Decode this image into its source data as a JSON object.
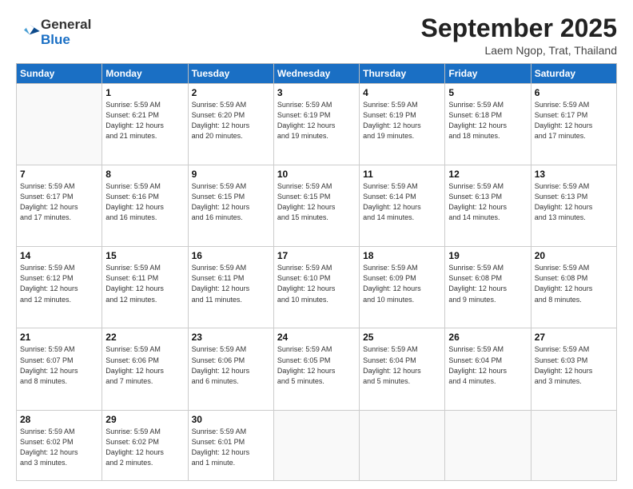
{
  "logo": {
    "general": "General",
    "blue": "Blue"
  },
  "title": "September 2025",
  "location": "Laem Ngop, Trat, Thailand",
  "weekdays": [
    "Sunday",
    "Monday",
    "Tuesday",
    "Wednesday",
    "Thursday",
    "Friday",
    "Saturday"
  ],
  "weeks": [
    [
      {
        "day": "",
        "info": ""
      },
      {
        "day": "1",
        "info": "Sunrise: 5:59 AM\nSunset: 6:21 PM\nDaylight: 12 hours\nand 21 minutes."
      },
      {
        "day": "2",
        "info": "Sunrise: 5:59 AM\nSunset: 6:20 PM\nDaylight: 12 hours\nand 20 minutes."
      },
      {
        "day": "3",
        "info": "Sunrise: 5:59 AM\nSunset: 6:19 PM\nDaylight: 12 hours\nand 19 minutes."
      },
      {
        "day": "4",
        "info": "Sunrise: 5:59 AM\nSunset: 6:19 PM\nDaylight: 12 hours\nand 19 minutes."
      },
      {
        "day": "5",
        "info": "Sunrise: 5:59 AM\nSunset: 6:18 PM\nDaylight: 12 hours\nand 18 minutes."
      },
      {
        "day": "6",
        "info": "Sunrise: 5:59 AM\nSunset: 6:17 PM\nDaylight: 12 hours\nand 17 minutes."
      }
    ],
    [
      {
        "day": "7",
        "info": "Sunrise: 5:59 AM\nSunset: 6:17 PM\nDaylight: 12 hours\nand 17 minutes."
      },
      {
        "day": "8",
        "info": "Sunrise: 5:59 AM\nSunset: 6:16 PM\nDaylight: 12 hours\nand 16 minutes."
      },
      {
        "day": "9",
        "info": "Sunrise: 5:59 AM\nSunset: 6:15 PM\nDaylight: 12 hours\nand 16 minutes."
      },
      {
        "day": "10",
        "info": "Sunrise: 5:59 AM\nSunset: 6:15 PM\nDaylight: 12 hours\nand 15 minutes."
      },
      {
        "day": "11",
        "info": "Sunrise: 5:59 AM\nSunset: 6:14 PM\nDaylight: 12 hours\nand 14 minutes."
      },
      {
        "day": "12",
        "info": "Sunrise: 5:59 AM\nSunset: 6:13 PM\nDaylight: 12 hours\nand 14 minutes."
      },
      {
        "day": "13",
        "info": "Sunrise: 5:59 AM\nSunset: 6:13 PM\nDaylight: 12 hours\nand 13 minutes."
      }
    ],
    [
      {
        "day": "14",
        "info": "Sunrise: 5:59 AM\nSunset: 6:12 PM\nDaylight: 12 hours\nand 12 minutes."
      },
      {
        "day": "15",
        "info": "Sunrise: 5:59 AM\nSunset: 6:11 PM\nDaylight: 12 hours\nand 12 minutes."
      },
      {
        "day": "16",
        "info": "Sunrise: 5:59 AM\nSunset: 6:11 PM\nDaylight: 12 hours\nand 11 minutes."
      },
      {
        "day": "17",
        "info": "Sunrise: 5:59 AM\nSunset: 6:10 PM\nDaylight: 12 hours\nand 10 minutes."
      },
      {
        "day": "18",
        "info": "Sunrise: 5:59 AM\nSunset: 6:09 PM\nDaylight: 12 hours\nand 10 minutes."
      },
      {
        "day": "19",
        "info": "Sunrise: 5:59 AM\nSunset: 6:08 PM\nDaylight: 12 hours\nand 9 minutes."
      },
      {
        "day": "20",
        "info": "Sunrise: 5:59 AM\nSunset: 6:08 PM\nDaylight: 12 hours\nand 8 minutes."
      }
    ],
    [
      {
        "day": "21",
        "info": "Sunrise: 5:59 AM\nSunset: 6:07 PM\nDaylight: 12 hours\nand 8 minutes."
      },
      {
        "day": "22",
        "info": "Sunrise: 5:59 AM\nSunset: 6:06 PM\nDaylight: 12 hours\nand 7 minutes."
      },
      {
        "day": "23",
        "info": "Sunrise: 5:59 AM\nSunset: 6:06 PM\nDaylight: 12 hours\nand 6 minutes."
      },
      {
        "day": "24",
        "info": "Sunrise: 5:59 AM\nSunset: 6:05 PM\nDaylight: 12 hours\nand 5 minutes."
      },
      {
        "day": "25",
        "info": "Sunrise: 5:59 AM\nSunset: 6:04 PM\nDaylight: 12 hours\nand 5 minutes."
      },
      {
        "day": "26",
        "info": "Sunrise: 5:59 AM\nSunset: 6:04 PM\nDaylight: 12 hours\nand 4 minutes."
      },
      {
        "day": "27",
        "info": "Sunrise: 5:59 AM\nSunset: 6:03 PM\nDaylight: 12 hours\nand 3 minutes."
      }
    ],
    [
      {
        "day": "28",
        "info": "Sunrise: 5:59 AM\nSunset: 6:02 PM\nDaylight: 12 hours\nand 3 minutes."
      },
      {
        "day": "29",
        "info": "Sunrise: 5:59 AM\nSunset: 6:02 PM\nDaylight: 12 hours\nand 2 minutes."
      },
      {
        "day": "30",
        "info": "Sunrise: 5:59 AM\nSunset: 6:01 PM\nDaylight: 12 hours\nand 1 minute."
      },
      {
        "day": "",
        "info": ""
      },
      {
        "day": "",
        "info": ""
      },
      {
        "day": "",
        "info": ""
      },
      {
        "day": "",
        "info": ""
      }
    ]
  ]
}
